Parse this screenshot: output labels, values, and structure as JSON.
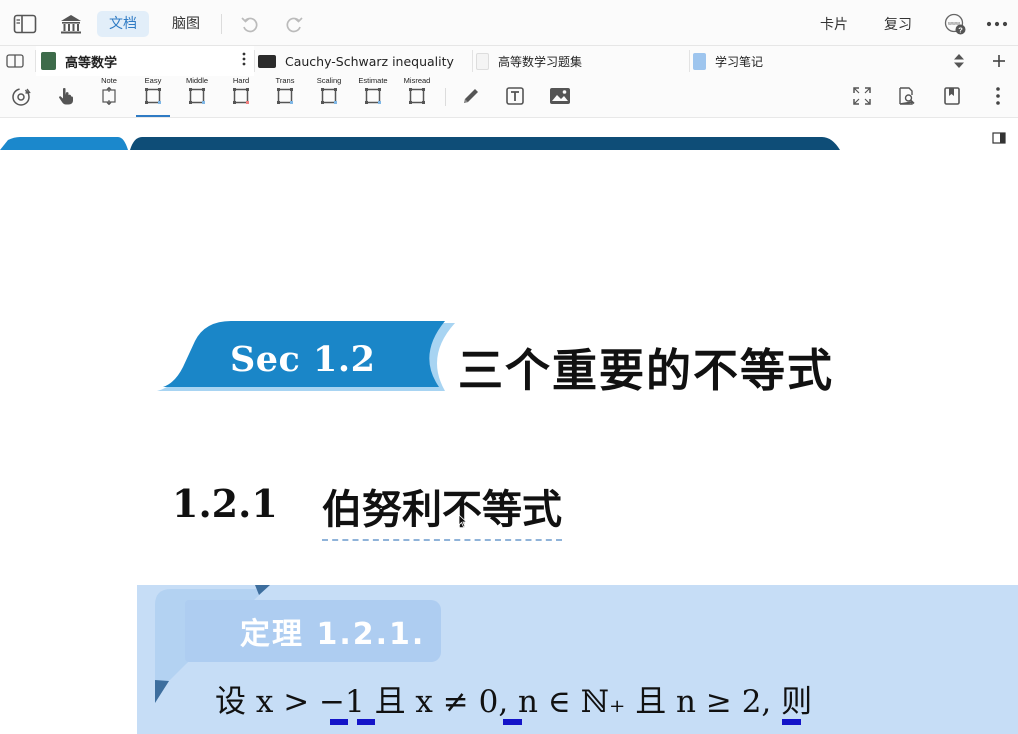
{
  "topbar": {
    "doc_tab": "文档",
    "mindmap_tab": "脑图",
    "cards": "卡片",
    "review": "复习"
  },
  "tabs": [
    {
      "label": "高等数学",
      "thumb_color": "#3d6b4a"
    },
    {
      "label": "Cauchy-Schwarz inequality",
      "thumb_color": "#2b2b2b"
    },
    {
      "label": "高等数学习题集",
      "thumb_color": "#f4f4f4"
    },
    {
      "label": "学习笔记",
      "thumb_color": "#9ec5ee"
    }
  ],
  "toolbar": {
    "tools": [
      "Note",
      "Easy",
      "Middle",
      "Hard",
      "Trans",
      "Scaling",
      "Estimate",
      "Misread"
    ],
    "selected_tool": "Easy",
    "icons": [
      "sync-icon",
      "hand-pointer-icon",
      "pen-icon",
      "text-box-icon",
      "image-icon",
      "fullscreen-icon",
      "search-document-icon",
      "bookmark-icon",
      "more-vertical-icon"
    ]
  },
  "document": {
    "section_badge": "Sec 1.2",
    "section_title": "三个重要的不等式",
    "subsection_number": "1.2.1",
    "subsection_title": "伯努利不等式",
    "theorem_label": "定理 1.2.1.",
    "theorem_text": "设 x > −1 且 x ≠ 0, n ∈ ℕ₊ 且 n ≥ 2, 则"
  },
  "colors": {
    "accent": "#2f7bc4",
    "badge_blue": "#1a86c8",
    "theorem_bg": "#c6ddf6",
    "highlight_mark": "#1414c8"
  }
}
